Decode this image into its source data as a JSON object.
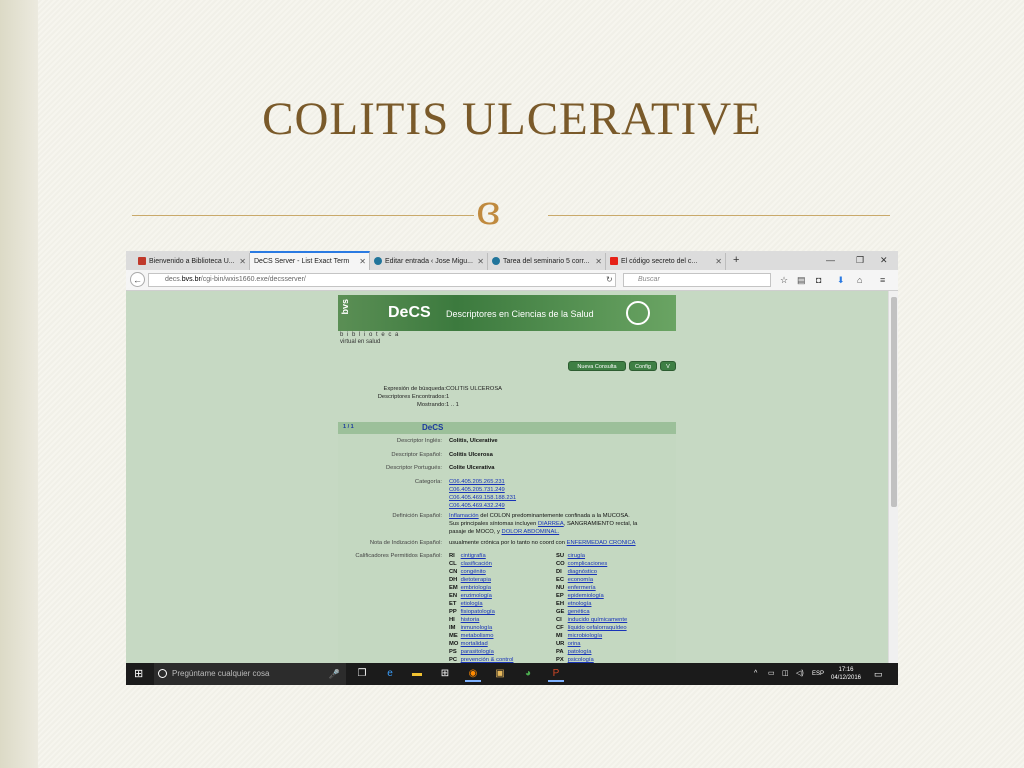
{
  "slide": {
    "title": "COLITIS ULCERATIVE",
    "ornament": "ɞ"
  },
  "browser": {
    "tabs": [
      {
        "label": "Bienvenido a Biblioteca U...",
        "color": "#c0392b",
        "active": false
      },
      {
        "label": "DeCS Server - List Exact Term",
        "color": "#cccccc",
        "active": true
      },
      {
        "label": "Editar entrada ‹ Jose Migu...",
        "color": "#21759b",
        "active": false
      },
      {
        "label": "Tarea del seminario 5 corr...",
        "color": "#21759b",
        "active": false
      },
      {
        "label": "El código secreto del c...",
        "color": "#e62117",
        "active": false
      }
    ],
    "url_prefix": "decs.",
    "url_host": "bvs.br",
    "url_path": "/cgi-bin/wxis1660.exe/decsserver/",
    "search_placeholder": "Buscar"
  },
  "decs": {
    "bvs": "bvs",
    "decs_logo": "DeCS",
    "banner_subtitle": "Descriptores en Ciencias de la Salud",
    "biblioteca": "b i b l i o t e c a",
    "virtual": "virtual en salud",
    "buttons": {
      "nueva": "Nueva Consulta",
      "config": "Config",
      "v": "V"
    },
    "summary": [
      {
        "key": "Expresión de búsqueda:",
        "value": "COLITIS ULCEROSA"
      },
      {
        "key": "Descriptores Encontrados:",
        "value": "1"
      },
      {
        "key": "Mostrando:",
        "value": "1 .. 1"
      }
    ],
    "table_count": "1 / 1",
    "table_title": "DeCS",
    "labels": {
      "ingles": "Descriptor Inglés:",
      "espanol": "Descriptor Español:",
      "portugues": "Descriptor Portugués:",
      "categoria": "Categoría:",
      "definicion": "Definición Español:",
      "nota": "Nota de Indización Español:",
      "calificadores": "Calificadores Permitidos Español:"
    },
    "values": {
      "ingles": "Colitis, Ulcerative",
      "espanol": "Colitis Ulcerosa",
      "portugues": "Colite Ulcerativa",
      "categorias": [
        "C06.405.205.265.231",
        "C06.405.205.731.249",
        "C06.405.469.158.188.231",
        "C06.405.469.432.249"
      ],
      "def_1a": "Inflamación",
      "def_1b": " del COLON predominantemente confinada a la MUCOSA.",
      "def_2a": "Sus principales síntomas incluyen ",
      "def_2b": "DIARREA",
      "def_2c": ", SANGRAMIENTO rectal, la",
      "def_3a": "pasaje de MOCO, y ",
      "def_3b": "DOLOR ABDOMINAL.",
      "nota_a": "usualmente crónica por lo tanto no coord con ",
      "nota_b": "ENFERMEDAD CRONICA"
    },
    "qualifiers_left": [
      {
        "code": "RI",
        "term": "cintigrafía"
      },
      {
        "code": "CL",
        "term": "clasificación"
      },
      {
        "code": "CN",
        "term": "congénito"
      },
      {
        "code": "DH",
        "term": "dietoterapia"
      },
      {
        "code": "EM",
        "term": "embriología"
      },
      {
        "code": "EN",
        "term": "enzimología"
      },
      {
        "code": "ET",
        "term": "etiología"
      },
      {
        "code": "PP",
        "term": "fisiopatología"
      },
      {
        "code": "HI",
        "term": "historia"
      },
      {
        "code": "IM",
        "term": "inmunología"
      },
      {
        "code": "ME",
        "term": "metabolismo"
      },
      {
        "code": "MO",
        "term": "mortalidad"
      },
      {
        "code": "PS",
        "term": "parasitología"
      },
      {
        "code": "PC",
        "term": "prevención & control"
      }
    ],
    "qualifiers_right": [
      {
        "code": "SU",
        "term": "cirugía"
      },
      {
        "code": "CO",
        "term": "complicaciones"
      },
      {
        "code": "DI",
        "term": "diagnóstico"
      },
      {
        "code": "EC",
        "term": "economía"
      },
      {
        "code": "NU",
        "term": "enfermería"
      },
      {
        "code": "EP",
        "term": "epidemiología"
      },
      {
        "code": "EH",
        "term": "etnología"
      },
      {
        "code": "GE",
        "term": "genética"
      },
      {
        "code": "CI",
        "term": "inducido químicamente"
      },
      {
        "code": "CF",
        "term": "líquido cefalorraquídeo"
      },
      {
        "code": "MI",
        "term": "microbiología"
      },
      {
        "code": "UR",
        "term": "orina"
      },
      {
        "code": "PA",
        "term": "patología"
      },
      {
        "code": "PX",
        "term": "psicología"
      }
    ]
  },
  "taskbar": {
    "search_placeholder": "Pregúntame cualquier cosa",
    "lang": "ESP",
    "time": "17:16",
    "date": "04/12/2016"
  }
}
